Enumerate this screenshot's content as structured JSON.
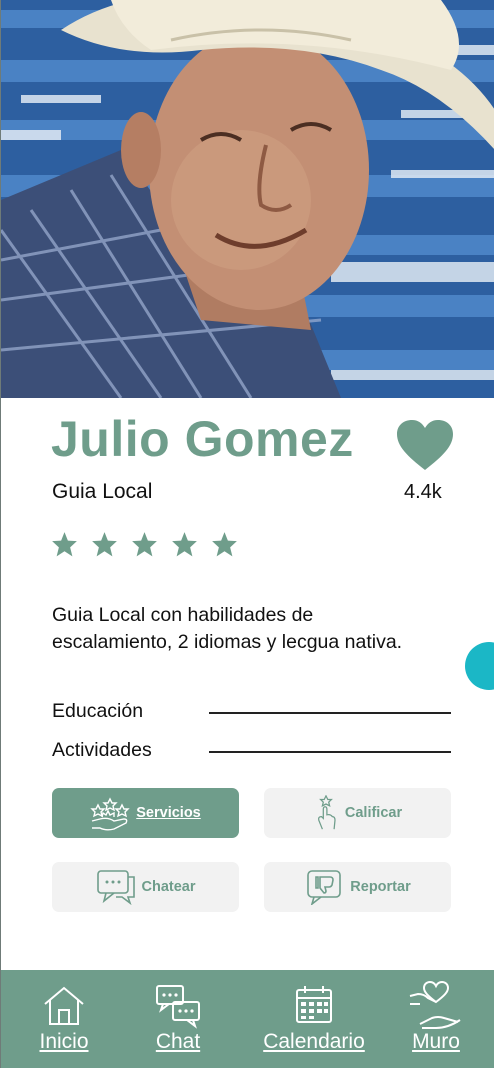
{
  "profile": {
    "name": "Julio Gomez",
    "role": "Guia Local",
    "likes": "4.4k",
    "rating": 5,
    "description": "Guia Local con habilidades de escalamiento, 2 idiomas y lecgua nativa."
  },
  "fields": {
    "education_label": "Educación",
    "activities_label": "Actividades"
  },
  "actions": {
    "services_label": "Servicios",
    "rate_label": "Calificar",
    "chat_label": "Chatear",
    "report_label": "Reportar"
  },
  "nav": {
    "items": [
      {
        "label": "Inicio",
        "icon": "home-icon"
      },
      {
        "label": "Chat",
        "icon": "chat-bubbles-icon"
      },
      {
        "label": "Calendario",
        "icon": "calendar-icon"
      },
      {
        "label": "Muro",
        "icon": "heart-hand-icon"
      }
    ]
  },
  "colors": {
    "accent": "#6f9d8b",
    "button_bg": "#f2f2f2",
    "floating_dot": "#1bb7c6"
  }
}
